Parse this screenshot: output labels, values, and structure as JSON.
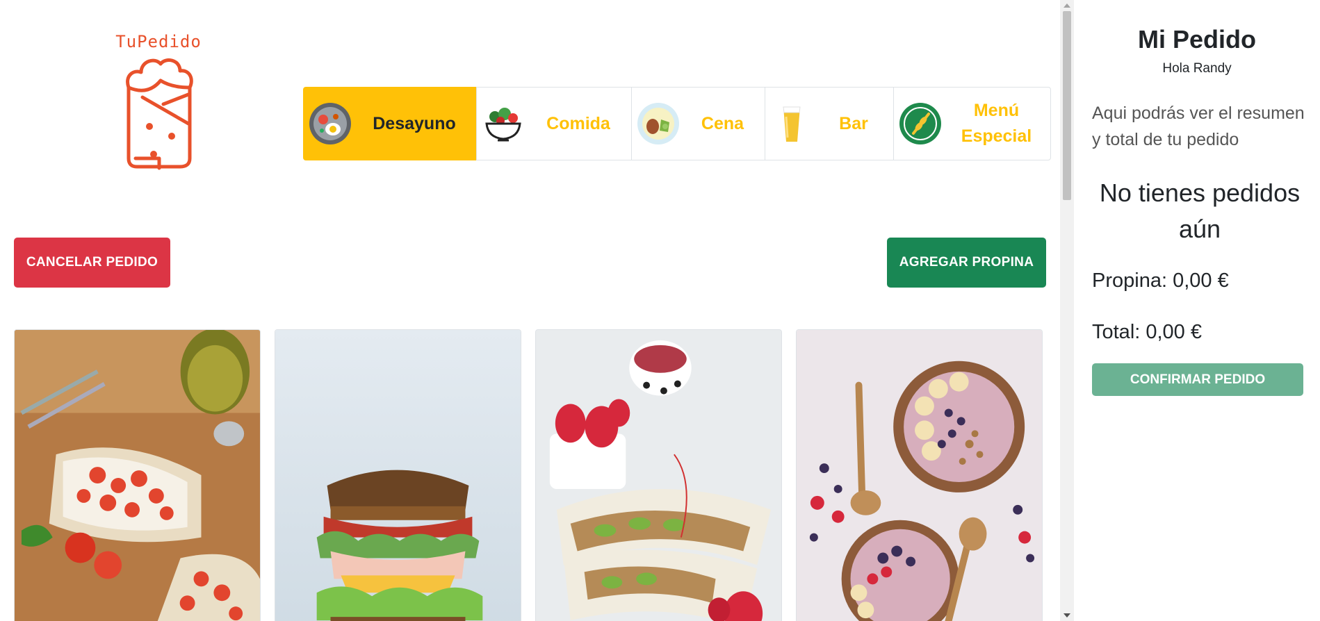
{
  "brand": {
    "name": "TuPedido",
    "logo_icon": "wrap-burrito-icon",
    "color": "#e8512b"
  },
  "categories": [
    {
      "label": "Desayuno",
      "icon": "breakfast-plate-icon",
      "active": true
    },
    {
      "label": "Comida",
      "icon": "salad-bowl-icon",
      "active": false
    },
    {
      "label": "Cena",
      "icon": "dinner-plate-icon",
      "active": false
    },
    {
      "label": "Bar",
      "icon": "beer-glass-icon",
      "active": false
    },
    {
      "label": "Menú Especial",
      "icon": "gluten-free-badge-icon",
      "active": false
    }
  ],
  "actions": {
    "cancel_label": "CANCELAR PEDIDO",
    "tip_label": "AGREGAR PROPINA"
  },
  "products": [
    {
      "image": "bruschetta-toast-photo"
    },
    {
      "image": "club-sandwich-photo"
    },
    {
      "image": "wrap-with-strawberries-photo"
    },
    {
      "image": "acai-bowl-photo"
    }
  ],
  "order": {
    "title": "Mi Pedido",
    "greeting": "Hola Randy",
    "description": "Aqui podrás ver el resumen y total de tu pedido",
    "empty_message": "No tienes pedidos aún",
    "tip_text": "Propina: 0,00 €",
    "total_text": "Total: 0,00 €",
    "confirm_label": "CONFIRMAR PEDIDO"
  },
  "colors": {
    "active_category": "#ffc107",
    "cancel": "#dc3545",
    "tip": "#198754",
    "confirm": "#6bb293"
  }
}
